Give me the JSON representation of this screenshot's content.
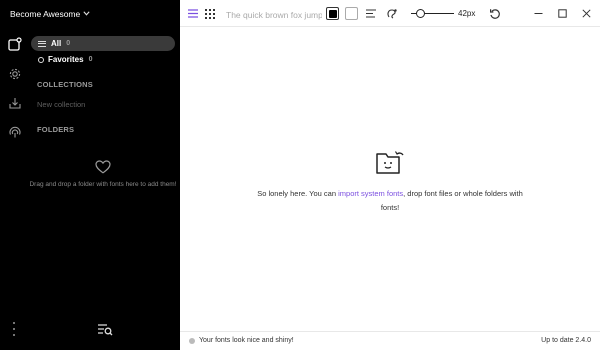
{
  "workspace": {
    "name": "Become Awesome"
  },
  "sidebar": {
    "nav": [
      {
        "label": "All",
        "count": "0"
      },
      {
        "label": "Favorites",
        "count": "0"
      }
    ],
    "collections_title": "COLLECTIONS",
    "new_collection": "New collection",
    "folders_title": "FOLDERS",
    "folders_empty": "Drag and drop a folder with fonts here to add them!"
  },
  "toolbar": {
    "sample_text": "The quick brown fox jumps over the lazy dog",
    "size": "42px",
    "size_level_percent": 15
  },
  "empty_state": {
    "text_before": "So lonely here. You can ",
    "link": "import system fonts",
    "text_after": ", drop font files or whole folders with fonts!"
  },
  "status": {
    "message": "Your fonts look nice and shiny!",
    "version": "Up to date 2.4.0"
  },
  "colors": {
    "accent": "#7b4fe0",
    "sidebar_bg": "#000000",
    "active_item_bg": "#3a3a3a"
  }
}
